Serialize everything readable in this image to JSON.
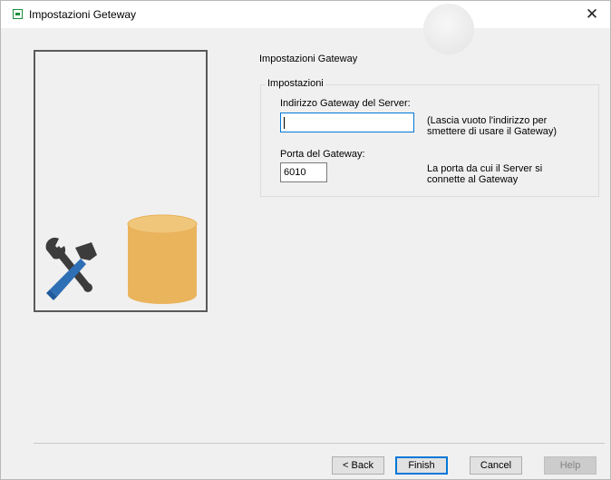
{
  "window": {
    "title": "Impostazioni Geteway",
    "close_glyph": "✕",
    "app_icon": "app-window-icon"
  },
  "illustration": {
    "icons": [
      "tools-icon",
      "database-icon"
    ],
    "colors": {
      "database": "#eab45d",
      "hammer_handle": "#2f6fb5",
      "tool_metal": "#3c3c3c"
    }
  },
  "page": {
    "heading": "Impostazioni Gateway",
    "group": {
      "legend": "Impostazioni",
      "server_address": {
        "label": "Indirizzo Gateway del Server:",
        "value": "",
        "hint_line1": "(Lascia vuoto l'indirizzo per",
        "hint_line2": "smettere di usare il Gateway)"
      },
      "port": {
        "label": "Porta del Gateway:",
        "value": "6010",
        "hint_line1": "La porta da cui il Server si",
        "hint_line2": "connette al Gateway"
      }
    }
  },
  "buttons": {
    "back": "< Back",
    "finish": "Finish",
    "cancel": "Cancel",
    "help": "Help"
  }
}
